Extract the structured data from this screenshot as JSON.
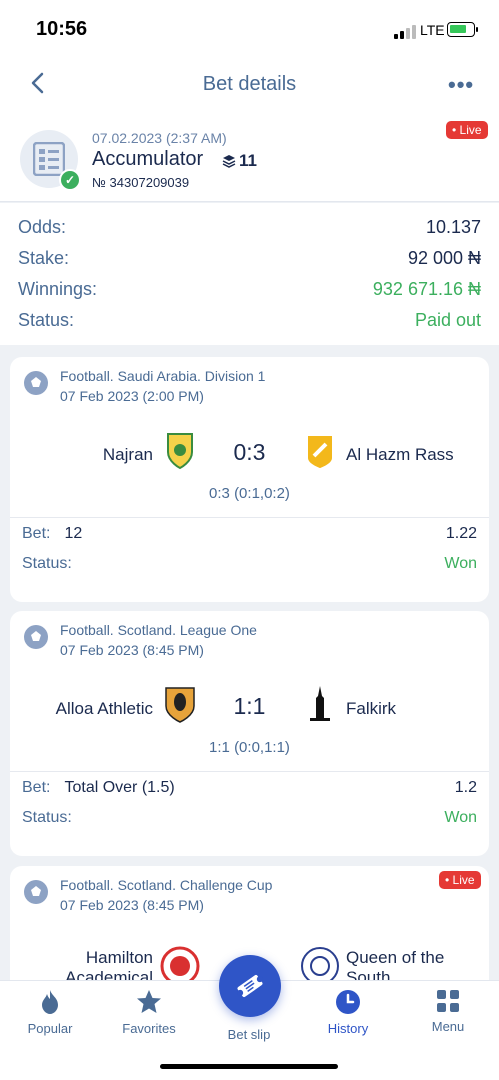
{
  "status_bar": {
    "time": "10:56",
    "network": "LTE"
  },
  "nav": {
    "title": "Bet details",
    "more": "•••"
  },
  "summary": {
    "date": "07.02.2023 (2:37 AM)",
    "type": "Accumulator",
    "selections_count": "11",
    "number": "№ 34307209039",
    "live_badge": "Live"
  },
  "details": {
    "odds_label": "Odds:",
    "odds_value": "10.137",
    "stake_label": "Stake:",
    "stake_value": "92 000 ₦",
    "winnings_label": "Winnings:",
    "winnings_value": "932 671.16 ₦",
    "status_label": "Status:",
    "status_value": "Paid out"
  },
  "events": [
    {
      "league": "Football. Saudi Arabia. Division 1",
      "date": "07 Feb 2023 (2:00 PM)",
      "home": "Najran",
      "away": "Al Hazm Rass",
      "score": "0:3",
      "score_detail": "0:3 (0:1,0:2)",
      "bet_label": "Bet:",
      "bet": "12",
      "odd": "1.22",
      "status_label": "Status:",
      "status": "Won"
    },
    {
      "league": "Football. Scotland. League One",
      "date": "07 Feb 2023 (8:45 PM)",
      "home": "Alloa Athletic",
      "away": "Falkirk",
      "score": "1:1",
      "score_detail": "1:1 (0:0,1:1)",
      "bet_label": "Bet:",
      "bet": "Total Over (1.5)",
      "odd": "1.2",
      "status_label": "Status:",
      "status": "Won"
    },
    {
      "league": "Football. Scotland. Challenge Cup",
      "date": "07 Feb 2023 (8:45 PM)",
      "home": "Hamilton Academical",
      "away": "Queen of the South",
      "live_badge": "Live"
    }
  ],
  "tabs": [
    {
      "label": "Popular",
      "icon": "flame-icon"
    },
    {
      "label": "Favorites",
      "icon": "star-icon"
    },
    {
      "label": "Bet slip",
      "icon": "ticket-icon"
    },
    {
      "label": "History",
      "icon": "clock-icon",
      "active": true
    },
    {
      "label": "Menu",
      "icon": "grid-icon"
    }
  ],
  "colors": {
    "accent": "#2f55c7",
    "win": "#3caf5e",
    "live": "#e53935",
    "muted": "#4a6b94"
  }
}
